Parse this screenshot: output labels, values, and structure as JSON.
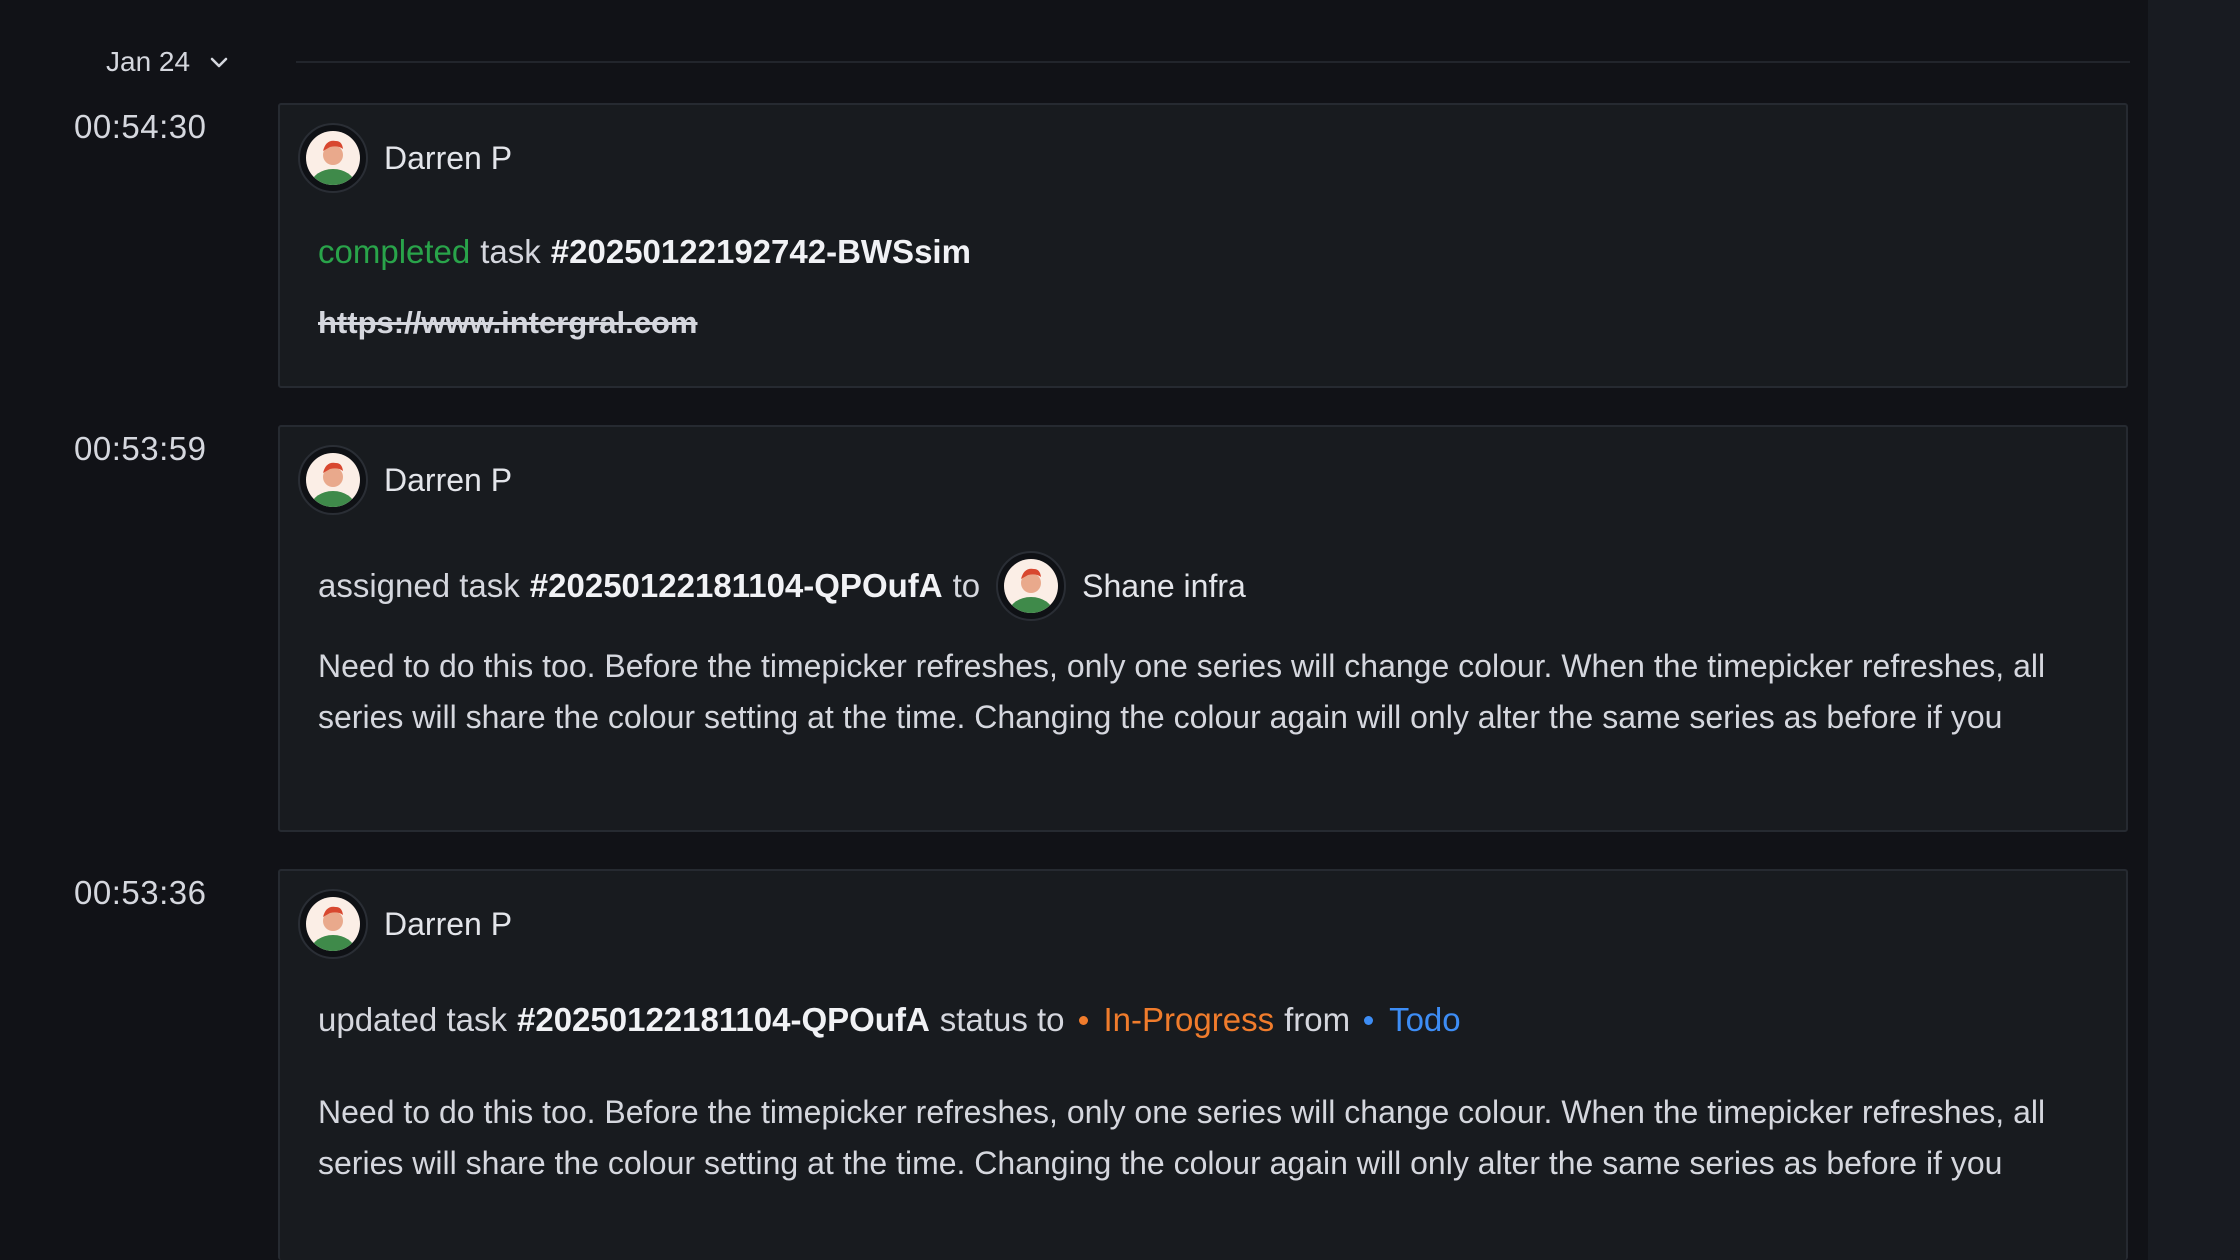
{
  "date_group": {
    "label": "Jan 24",
    "toggle_icon": "chevron-down-icon"
  },
  "entries": [
    {
      "time": "00:54:30",
      "user": "Darren P",
      "action": "completed",
      "object_word": "task",
      "task_id": "#20250122192742-BWSsim",
      "link": "https://www.intergral.com",
      "action_color": "#29a44a"
    },
    {
      "time": "00:53:59",
      "user": "Darren P",
      "action": "assigned task",
      "task_id": "#20250122181104-QPOufA",
      "connector": "to",
      "assignee": "Shane infra",
      "description": "Need to do this too. Before the timepicker refreshes, only one series will change colour. When the timepicker refreshes, all series will share the colour setting at the time. Changing the colour again will only alter the same series as before if you"
    },
    {
      "time": "00:53:36",
      "user": "Darren P",
      "action": "updated task",
      "task_id": "#20250122181104-QPOufA",
      "connector": "status to",
      "new_status": "In-Progress",
      "new_status_color": "#f07c2c",
      "from_word": "from",
      "old_status": "Todo",
      "old_status_color": "#3d8df5",
      "description": "Need to do this too. Before the timepicker refreshes, only one series will change colour. When the timepicker refreshes, all series will share the colour setting at the time. Changing the colour again will only alter the same series as before if you"
    }
  ]
}
